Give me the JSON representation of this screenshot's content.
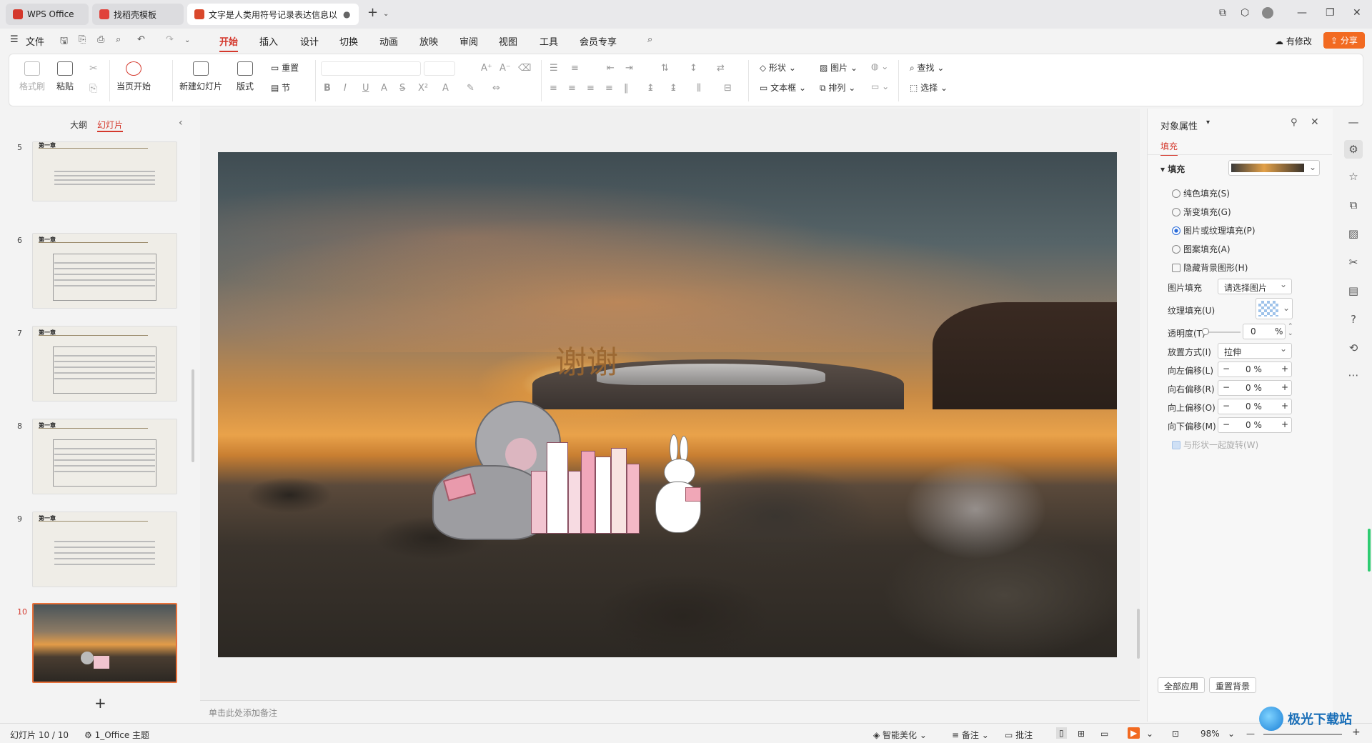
{
  "titlebar": {
    "tabs": [
      {
        "label": "WPS Office"
      },
      {
        "label": "找稻壳模板"
      },
      {
        "label": "文字是人类用符号记录表达信息以"
      }
    ],
    "new_tab": "+"
  },
  "menubar": {
    "file": "文件",
    "items": [
      "开始",
      "插入",
      "设计",
      "切换",
      "动画",
      "放映",
      "审阅",
      "视图",
      "工具",
      "会员专享"
    ],
    "selected": "开始",
    "edit_status": "有修改",
    "share": "分享"
  },
  "ribbon": {
    "format_brush": "格式刷",
    "paste": "粘贴",
    "from_current": "当页开始",
    "new_slide": "新建幻灯片",
    "layout": "版式",
    "reset": "重置",
    "section": "节",
    "shape": "形状",
    "picture": "图片",
    "textbox": "文本框",
    "arrange": "排列",
    "find": "查找",
    "select": "选择"
  },
  "left_panel": {
    "tab_outline": "大纲",
    "tab_slides": "幻灯片",
    "slides": [
      {
        "num": "5",
        "heading": "第一章"
      },
      {
        "num": "6",
        "heading": "第一章"
      },
      {
        "num": "7",
        "heading": "第一章"
      },
      {
        "num": "8",
        "heading": "第一章"
      },
      {
        "num": "9",
        "heading": "第一章"
      },
      {
        "num": "10",
        "heading": ""
      }
    ],
    "add": "+"
  },
  "slide": {
    "title": "谢谢"
  },
  "notes": {
    "placeholder": "单击此处添加备注"
  },
  "right_panel": {
    "title": "对象属性",
    "tab_fill": "填充",
    "section_fill": "填充",
    "options": [
      {
        "label": "纯色填充(S)",
        "selected": false
      },
      {
        "label": "渐变填充(G)",
        "selected": false
      },
      {
        "label": "图片或纹理填充(P)",
        "selected": true
      },
      {
        "label": "图案填充(A)",
        "selected": false
      }
    ],
    "hide_bg": "隐藏背景图形(H)",
    "picture_fill_label": "图片填充",
    "picture_fill_value": "请选择图片",
    "texture_fill_label": "纹理填充(U)",
    "transparency_label": "透明度(T)",
    "transparency_value": "0",
    "transparency_unit": "%",
    "placement_label": "放置方式(I)",
    "placement_value": "拉伸",
    "offsets": [
      {
        "label": "向左偏移(L)",
        "value": "0 %"
      },
      {
        "label": "向右偏移(R)",
        "value": "0 %"
      },
      {
        "label": "向上偏移(O)",
        "value": "0 %"
      },
      {
        "label": "向下偏移(M)",
        "value": "0 %"
      }
    ],
    "rotate_with_shape": "与形状一起旋转(W)",
    "apply_all": "全部应用",
    "reset_bg": "重置背景"
  },
  "statusbar": {
    "slide_info": "幻灯片 10 / 10",
    "theme": "1_Office 主题",
    "beautify": "智能美化",
    "notes": "备注",
    "comments": "批注",
    "zoom": "98%"
  },
  "watermark": {
    "site": "极光下载站"
  },
  "colors": {
    "accent": "#d4382c",
    "share_bg": "#f26a21",
    "radio_blue": "#2a6bd8"
  }
}
